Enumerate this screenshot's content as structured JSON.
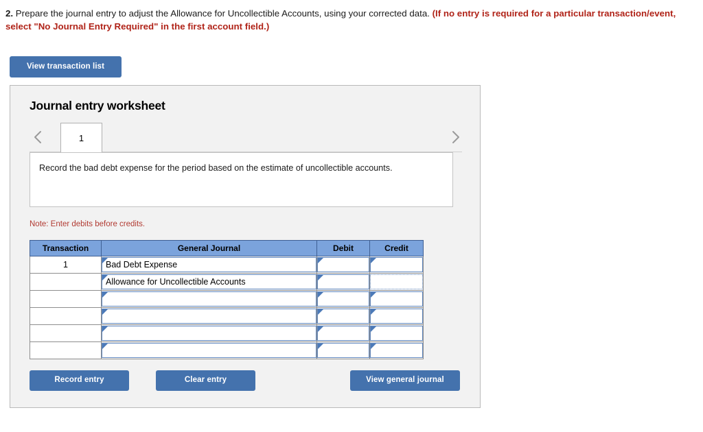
{
  "question": {
    "number": "2.",
    "text": " Prepare the journal entry to adjust the Allowance for Uncollectible Accounts, using your corrected data. ",
    "red_note": "(If no entry is required for a particular transaction/event, select \"No Journal Entry Required\" in the first account field.)"
  },
  "toolbar": {
    "view_transaction_list_label": "View transaction list"
  },
  "worksheet": {
    "title": "Journal entry worksheet",
    "tabs": [
      {
        "label": "1",
        "active": true
      }
    ],
    "prev_icon": "chevron-left-icon",
    "next_icon": "chevron-right-icon",
    "instruction": "Record the bad debt expense for the period based on the estimate of uncollectible accounts.",
    "note": "Note: Enter debits before credits."
  },
  "table": {
    "headers": [
      "Transaction",
      "General Journal",
      "Debit",
      "Credit"
    ],
    "rows": [
      {
        "transaction": "1",
        "journal": "Bad Debt Expense",
        "debit": "",
        "credit": "",
        "credit_focused": false
      },
      {
        "transaction": "",
        "journal": "Allowance for Uncollectible Accounts",
        "debit": "",
        "credit": "",
        "credit_focused": true
      },
      {
        "transaction": "",
        "journal": "",
        "debit": "",
        "credit": "",
        "credit_focused": false
      },
      {
        "transaction": "",
        "journal": "",
        "debit": "",
        "credit": "",
        "credit_focused": false
      },
      {
        "transaction": "",
        "journal": "",
        "debit": "",
        "credit": "",
        "credit_focused": false
      },
      {
        "transaction": "",
        "journal": "",
        "debit": "",
        "credit": "",
        "credit_focused": false
      }
    ]
  },
  "actions": {
    "record_entry_label": "Record entry",
    "clear_entry_label": "Clear entry",
    "view_general_journal_label": "View general journal"
  },
  "colors": {
    "button_blue": "#4472ad",
    "table_header_blue": "#7ba3dc",
    "field_border_blue": "#5f87bf",
    "note_red": "#b13a32",
    "prompt_red": "#b02318",
    "panel_gray": "#f2f2f2"
  }
}
